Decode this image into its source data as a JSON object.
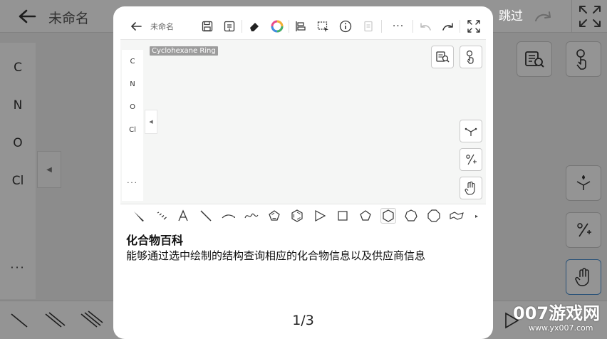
{
  "background_app": {
    "title": "未命名",
    "elements": [
      "C",
      "N",
      "O",
      "Cl"
    ],
    "more_label": "···"
  },
  "onboarding": {
    "skip_label": "跳过",
    "card": {
      "feature_title": "化合物百科",
      "feature_description": "能够通过选中绘制的结构查询相应的化合物信息以及供应商信息",
      "page_indicator": "1/3"
    },
    "preview": {
      "doc_title": "未命名",
      "tooltip": "Cyclohexane Ring",
      "elements": [
        "C",
        "N",
        "O",
        "Cl"
      ],
      "more_label": "···",
      "active_shape": "hexagon-icon"
    }
  },
  "watermark": {
    "brand": "007游戏网",
    "url": "www.yx007.com"
  }
}
